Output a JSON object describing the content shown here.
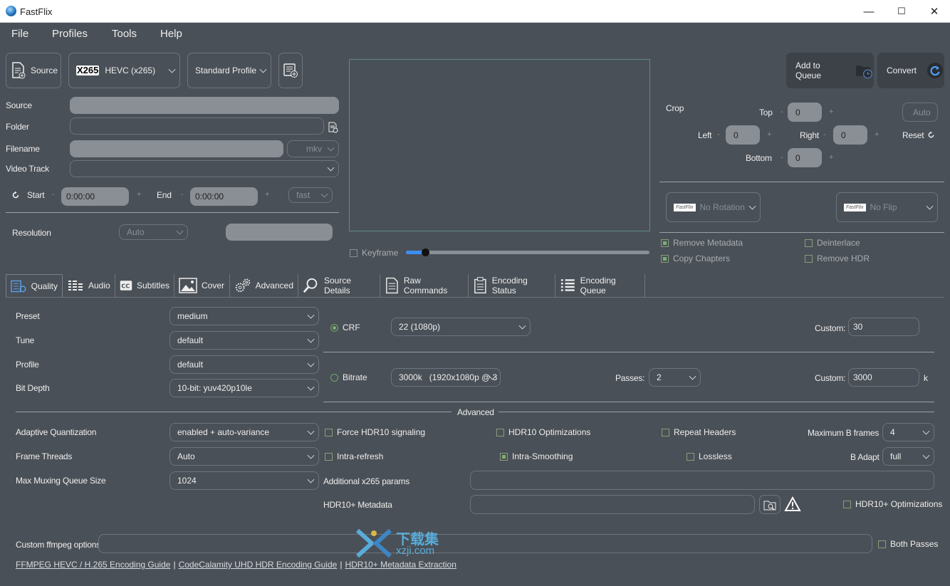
{
  "window": {
    "title": "FastFlix",
    "min": "—",
    "max": "☐",
    "close": "✕"
  },
  "menu": [
    "File",
    "Profiles",
    "Tools",
    "Help"
  ],
  "toolbar": {
    "source_label": "Source",
    "encoder_brand": "X265",
    "encoder_label": "HEVC (x265)",
    "profile_label": "Standard Profile",
    "add_queue_label": "Add to Queue",
    "convert_label": "Convert"
  },
  "form": {
    "source_label": "Source",
    "folder_label": "Folder",
    "filename_label": "Filename",
    "ext_value": "mkv",
    "video_track_label": "Video Track",
    "start_label": "Start",
    "start_value": "0:00:00",
    "end_label": "End",
    "end_value": "0:00:00",
    "seek_value": "fast",
    "resolution_label": "Resolution",
    "resolution_value": "Auto",
    "pm": "-",
    "pl": "+"
  },
  "preview": {
    "keyframe_label": "Keyframe",
    "slider_fraction": 0.08
  },
  "crop": {
    "label": "Crop",
    "top_label": "Top",
    "top_value": "0",
    "left_label": "Left",
    "left_value": "0",
    "right_label": "Right",
    "right_value": "0",
    "bottom_label": "Bottom",
    "bottom_value": "0",
    "auto_label": "Auto",
    "reset_label": "Reset",
    "minus": "-",
    "plus": "+"
  },
  "transform": {
    "rotation_logo": "FastFlix",
    "rotation_label": "No Rotation",
    "flip_logo": "FastFlix",
    "flip_label": "No Flip"
  },
  "options": {
    "remove_metadata": "Remove Metadata",
    "copy_chapters": "Copy Chapters",
    "deinterlace": "Deinterlace",
    "remove_hdr": "Remove HDR"
  },
  "tabs": [
    {
      "label": "Quality",
      "icon": "quality-icon"
    },
    {
      "label": "Audio",
      "icon": "audio-icon"
    },
    {
      "label": "Subtitles",
      "icon": "cc-icon"
    },
    {
      "label": "Cover",
      "icon": "image-icon"
    },
    {
      "label": "Advanced",
      "icon": "gears-icon"
    },
    {
      "label": "Source Details",
      "icon": "magnifier-icon"
    },
    {
      "label": "Raw Commands",
      "icon": "document-icon"
    },
    {
      "label": "Encoding Status",
      "icon": "clipboard-icon"
    },
    {
      "label": "Encoding Queue",
      "icon": "list-icon"
    }
  ],
  "quality": {
    "preset_label": "Preset",
    "preset_value": "medium",
    "tune_label": "Tune",
    "tune_value": "default",
    "profile_label": "Profile",
    "profile_value": "default",
    "bitdepth_label": "Bit Depth",
    "bitdepth_value": "10-bit: yuv420p10le",
    "crf_label": "CRF",
    "crf_value": "22 (1080p)",
    "crf_custom_label": "Custom:",
    "crf_custom_value": "30",
    "bitrate_label": "Bitrate",
    "bitrate_value": "3000k   (1920x1080p @ 3",
    "passes_label": "Passes:",
    "passes_value": "2",
    "bitrate_custom_label": "Custom:",
    "bitrate_custom_value": "3000",
    "bitrate_unit": "k",
    "advanced_label": "Advanced",
    "aq_label": "Adaptive Quantization",
    "aq_value": "enabled + auto-variance",
    "threads_label": "Frame Threads",
    "threads_value": "Auto",
    "muxq_label": "Max Muxing Queue Size",
    "muxq_value": "1024",
    "force_hdr10": "Force HDR10 signaling",
    "hdr10_opt": "HDR10 Optimizations",
    "repeat_headers": "Repeat Headers",
    "max_b_label": "Maximum B frames",
    "max_b_value": "4",
    "intra_refresh": "Intra-refresh",
    "intra_smoothing": "Intra-Smoothing",
    "lossless": "Lossless",
    "b_adapt_label": "B Adapt",
    "b_adapt_value": "full",
    "x265_params_label": "Additional x265 params",
    "hdr10plus_label": "HDR10+ Metadata",
    "hdr10plus_opt": "HDR10+ Optimizations",
    "ffmpeg_label": "Custom ffmpeg options",
    "both_passes": "Both Passes",
    "link1": "FFMPEG HEVC / H.265 Encoding Guide",
    "link2": "CodeCalamity UHD HDR Encoding Guide",
    "link3": "HDR10+ Metadata Extraction",
    "sep": "|"
  },
  "watermark": {
    "cn": "下载集",
    "url": "xzji.com"
  }
}
